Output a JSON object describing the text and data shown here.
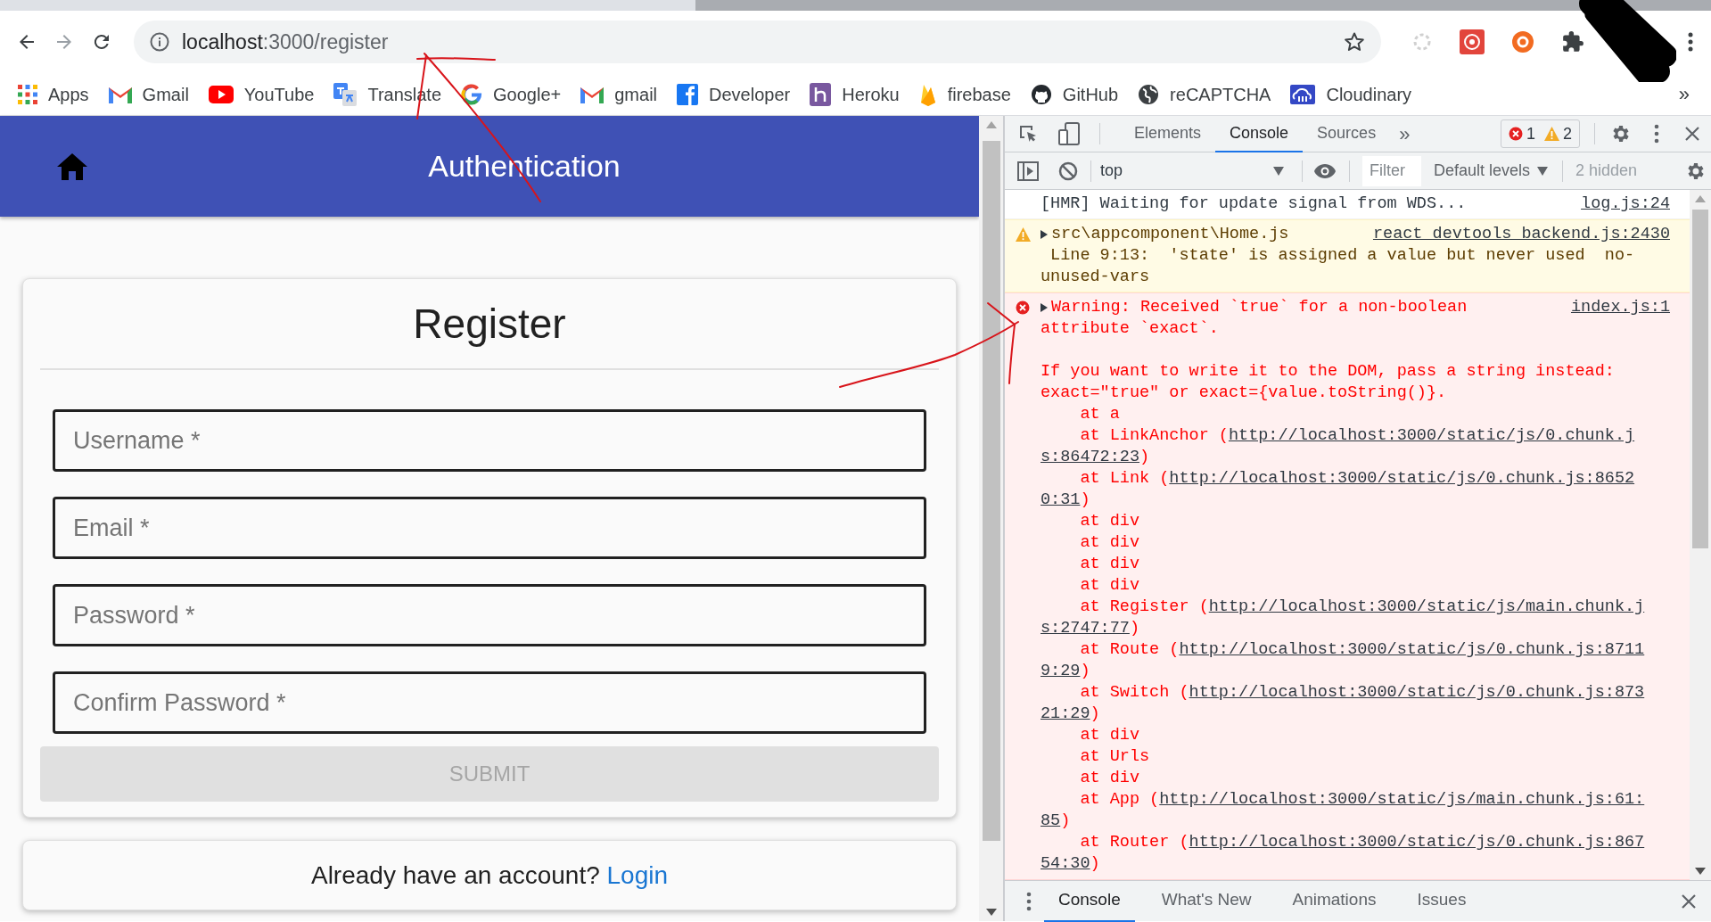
{
  "browser": {
    "forward": {
      "disabled": true
    },
    "address_bar": {
      "host": "localhost",
      "path": ":3000/register"
    },
    "bookmarks": [
      {
        "label": "Apps",
        "kind": "apps"
      },
      {
        "label": "Gmail",
        "kind": "gmail"
      },
      {
        "label": "YouTube",
        "kind": "youtube"
      },
      {
        "label": "Translate",
        "kind": "translate"
      },
      {
        "label": "Google+",
        "kind": "google"
      },
      {
        "label": "gmail",
        "kind": "gmail"
      },
      {
        "label": "Developer",
        "kind": "facebook"
      },
      {
        "label": "Heroku",
        "kind": "heroku"
      },
      {
        "label": "firebase",
        "kind": "firebase"
      },
      {
        "label": "GitHub",
        "kind": "github"
      },
      {
        "label": "reCAPTCHA",
        "kind": "globe"
      },
      {
        "label": "Cloudinary",
        "kind": "cloud"
      }
    ],
    "bookmarks_overflow": "»"
  },
  "page": {
    "app_bar": {
      "title": "Authentication"
    },
    "form": {
      "title": "Register",
      "fields": [
        {
          "placeholder": "Username *"
        },
        {
          "placeholder": "Email *"
        },
        {
          "placeholder": "Password *"
        },
        {
          "placeholder": "Confirm Password *"
        }
      ],
      "submit": {
        "label": "SUBMIT",
        "disabled": true
      }
    },
    "footer": {
      "text": "Already have an account?",
      "link": "Login"
    }
  },
  "devtools": {
    "tabs": [
      {
        "label": "Elements",
        "selected": false
      },
      {
        "label": "Console",
        "selected": true
      },
      {
        "label": "Sources",
        "selected": false
      }
    ],
    "tabs_overflow": "»",
    "error_count": "1",
    "warning_count": "2",
    "toolbar": {
      "context": "top",
      "filter": {
        "placeholder": "Filter"
      },
      "levels": "Default levels",
      "hidden": "2 hidden"
    },
    "messages": [
      {
        "kind": "info",
        "source": "log.js:24",
        "lines": [
          {
            "text": "[HMR] Waiting for update signal from WDS..."
          }
        ]
      },
      {
        "kind": "warning",
        "expandable": true,
        "source": "react_devtools_backend.js:2430",
        "lines": [
          {
            "text": "src\\appcomponent\\Home.js"
          },
          {
            "text": " Line 9:13:  'state' is assigned a value but never used  no-"
          },
          {
            "text": "unused-vars"
          }
        ]
      },
      {
        "kind": "error",
        "expandable": true,
        "source": "index.js:1",
        "lines": [
          {
            "text": "Warning: Received `true` for a non-boolean"
          },
          {
            "text": "attribute `exact`."
          },
          {
            "text": "If you want to write it to the DOM, pass a string instead:",
            "gap_before": true
          },
          {
            "text": "exact=\"true\" or exact={value.toString()}."
          },
          {
            "text": "    at a"
          },
          {
            "text": "    at LinkAnchor (",
            "link": "http://localhost:3000/static/js/0.chunk.j"
          },
          {
            "link": "s:86472:23",
            "tail": ")"
          },
          {
            "text": "    at Link (",
            "link": "http://localhost:3000/static/js/0.chunk.js:8652"
          },
          {
            "link": "0:31",
            "tail": ")"
          },
          {
            "text": "    at div"
          },
          {
            "text": "    at div"
          },
          {
            "text": "    at div"
          },
          {
            "text": "    at div"
          },
          {
            "text": "    at Register (",
            "link": "http://localhost:3000/static/js/main.chunk.j"
          },
          {
            "link": "s:2747:77",
            "tail": ")"
          },
          {
            "text": "    at Route (",
            "link": "http://localhost:3000/static/js/0.chunk.js:8711"
          },
          {
            "link": "9:29",
            "tail": ")"
          },
          {
            "text": "    at Switch (",
            "link": "http://localhost:3000/static/js/0.chunk.js:873"
          },
          {
            "link": "21:29",
            "tail": ")"
          },
          {
            "text": "    at div"
          },
          {
            "text": "    at Urls"
          },
          {
            "text": "    at div"
          },
          {
            "text": "    at App (",
            "link": "http://localhost:3000/static/js/main.chunk.js:61:"
          },
          {
            "link": "85",
            "tail": ")"
          },
          {
            "text": "    at Router (",
            "link": "http://localhost:3000/static/js/0.chunk.js:867"
          },
          {
            "link": "54:30",
            "tail": ")"
          }
        ]
      }
    ],
    "drawer_tabs": [
      {
        "label": "Console",
        "selected": true
      },
      {
        "label": "What's New",
        "selected": false
      },
      {
        "label": "Animations",
        "selected": false
      },
      {
        "label": "Issues",
        "selected": false
      }
    ]
  }
}
